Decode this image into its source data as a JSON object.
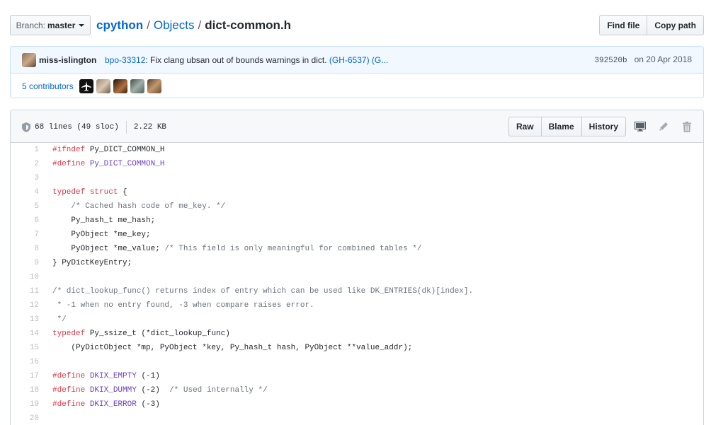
{
  "top_bar": {
    "branch_prefix": "Branch:",
    "branch_name": "master",
    "repo": "cpython",
    "directory": "Objects",
    "separator": "/",
    "file_name": "dict-common.h",
    "find_file_label": "Find file",
    "copy_path_label": "Copy path"
  },
  "commit": {
    "author": "miss-islington",
    "issue_link": "bpo-33312",
    "message": ": Fix clang ubsan out of bounds warnings in dict. ",
    "pr_link": "(GH-6537)",
    "more_link": "(G...",
    "sha": "392520b",
    "date": "on 20 Apr 2018",
    "contributors_label": "5 contributors"
  },
  "file": {
    "lines_info": "68 lines (49 sloc)",
    "size": "2.22 KB",
    "raw_label": "Raw",
    "blame_label": "Blame",
    "history_label": "History"
  },
  "code_lines": [
    {
      "n": "1",
      "parts": [
        [
          "k",
          "#ifndef"
        ],
        [
          "",
          " Py_DICT_COMMON_H"
        ]
      ]
    },
    {
      "n": "2",
      "parts": [
        [
          "k",
          "#define"
        ],
        [
          "n",
          " Py_DICT_COMMON_H"
        ]
      ]
    },
    {
      "n": "3",
      "parts": []
    },
    {
      "n": "4",
      "parts": [
        [
          "k",
          "typedef"
        ],
        [
          "",
          " "
        ],
        [
          "k",
          "struct"
        ],
        [
          "",
          " {"
        ]
      ]
    },
    {
      "n": "5",
      "parts": [
        [
          "",
          "    "
        ],
        [
          "c",
          "/* Cached hash code of me_key. */"
        ]
      ]
    },
    {
      "n": "6",
      "parts": [
        [
          "",
          "    Py_hash_t me_hash;"
        ]
      ]
    },
    {
      "n": "7",
      "parts": [
        [
          "",
          "    PyObject *me_key;"
        ]
      ]
    },
    {
      "n": "8",
      "parts": [
        [
          "",
          "    PyObject *me_value; "
        ],
        [
          "c",
          "/* This field is only meaningful for combined tables */"
        ]
      ]
    },
    {
      "n": "9",
      "parts": [
        [
          "",
          "} PyDictKeyEntry;"
        ]
      ]
    },
    {
      "n": "10",
      "parts": []
    },
    {
      "n": "11",
      "parts": [
        [
          "c",
          "/* dict_lookup_func() returns index of entry which can be used like DK_ENTRIES(dk)[index]."
        ]
      ]
    },
    {
      "n": "12",
      "parts": [
        [
          "c",
          " * -1 when no entry found, -3 when compare raises error."
        ]
      ]
    },
    {
      "n": "13",
      "parts": [
        [
          "c",
          " */"
        ]
      ]
    },
    {
      "n": "14",
      "parts": [
        [
          "k",
          "typedef"
        ],
        [
          "",
          " Py_ssize_t (*dict_lookup_func)"
        ]
      ]
    },
    {
      "n": "15",
      "parts": [
        [
          "",
          "    (PyDictObject *mp, PyObject *key, Py_hash_t hash, PyObject **value_addr);"
        ]
      ]
    },
    {
      "n": "16",
      "parts": []
    },
    {
      "n": "17",
      "parts": [
        [
          "k",
          "#define"
        ],
        [
          "n",
          " DKIX_EMPTY"
        ],
        [
          "",
          " (-1)"
        ]
      ]
    },
    {
      "n": "18",
      "parts": [
        [
          "k",
          "#define"
        ],
        [
          "n",
          " DKIX_DUMMY"
        ],
        [
          "",
          " (-2)  "
        ],
        [
          "c",
          "/* Used internally */"
        ]
      ]
    },
    {
      "n": "19",
      "parts": [
        [
          "k",
          "#define"
        ],
        [
          "n",
          " DKIX_ERROR"
        ],
        [
          "",
          " (-3)"
        ]
      ]
    },
    {
      "n": "20",
      "parts": []
    }
  ],
  "icons": {
    "branch_caret": "caret-down-icon",
    "shield": "shield-icon",
    "desktop": "desktop-icon",
    "pencil": "pencil-icon",
    "trash": "trash-icon"
  }
}
